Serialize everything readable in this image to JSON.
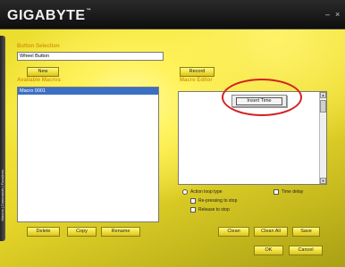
{
  "app": {
    "logo": "GIGABYTE",
    "logo_tm": "™",
    "minimize_glyph": "–",
    "close_glyph": "×",
    "side_tab_text": "Macros | Commands | Functions"
  },
  "button_selection": {
    "label": "Button Selection",
    "value": "Wheel Button",
    "new_label": "New"
  },
  "available_macros": {
    "label": "Available Macros",
    "items": [
      "Macro 0001"
    ]
  },
  "macro_editor": {
    "record_label": "Record",
    "label": "Macro Editor",
    "context_menu_item": "Insert Time",
    "options": {
      "action_loop_type": "Action loop type",
      "repressing_to_stop": "Re-pressing to stop",
      "release_to_stop": "Release to stop",
      "time_delay": "Time delay"
    }
  },
  "left_buttons": {
    "delete": "Delete",
    "copy": "Copy",
    "rename": "Rename"
  },
  "right_buttons": {
    "clean": "Clean",
    "clean_all": "Clean All",
    "save": "Save",
    "ok": "OK",
    "cancel": "Cancel"
  },
  "colors": {
    "accent": "#d49a0c",
    "highlight_ring": "#d42020",
    "selected_item": "#3b6fc4"
  }
}
